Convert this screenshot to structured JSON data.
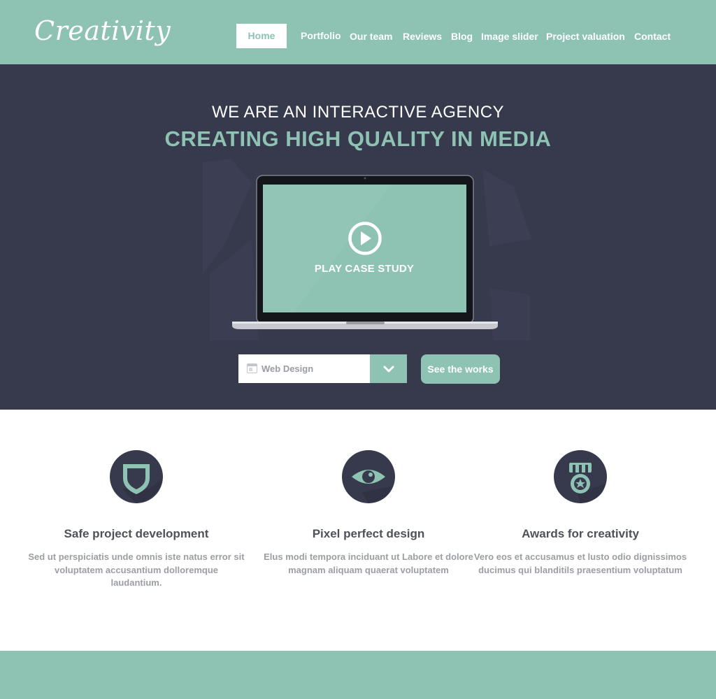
{
  "header": {
    "logo": "Creativity",
    "nav": {
      "home": "Home",
      "portfolio": "Portfolio",
      "our_team": "Our team",
      "reviews": "Reviews",
      "blog": "Blog",
      "image_slider": "Image slider",
      "project_valuation": "Project valuation",
      "contact": "Contact"
    }
  },
  "hero": {
    "line1": "WE ARE AN INTERACTIVE AGENCY",
    "line2": "CREATING HIGH QUALITY IN MEDIA",
    "video_label": "PLAY CASE STUDY",
    "category_select": {
      "value": "Web Design",
      "icon": "window-icon",
      "arrow_icon": "chevron-down-icon"
    },
    "works_button": "See the works"
  },
  "features": [
    {
      "icon": "shield-icon",
      "title": "Safe project development",
      "desc": "Sed ut perspiciatis unde omnis iste natus error sit voluptatem accusantium dolloremque laudantium."
    },
    {
      "icon": "eye-icon",
      "title": "Pixel perfect design",
      "desc": "Elus modi tempora inciduant ut Labore et dolore magnam aliquam quaerat voluptatem"
    },
    {
      "icon": "medal-icon",
      "title": "Awards for creativity",
      "desc": "Vero eos et accusamus et lusto odio dignissimos ducimus qui blanditils praesentium voluptatum"
    }
  ],
  "colors": {
    "accent": "#8ec2b3",
    "hero_bg": "#373a4d",
    "title_text": "#4f5158",
    "body_text": "#9c9ea5"
  }
}
